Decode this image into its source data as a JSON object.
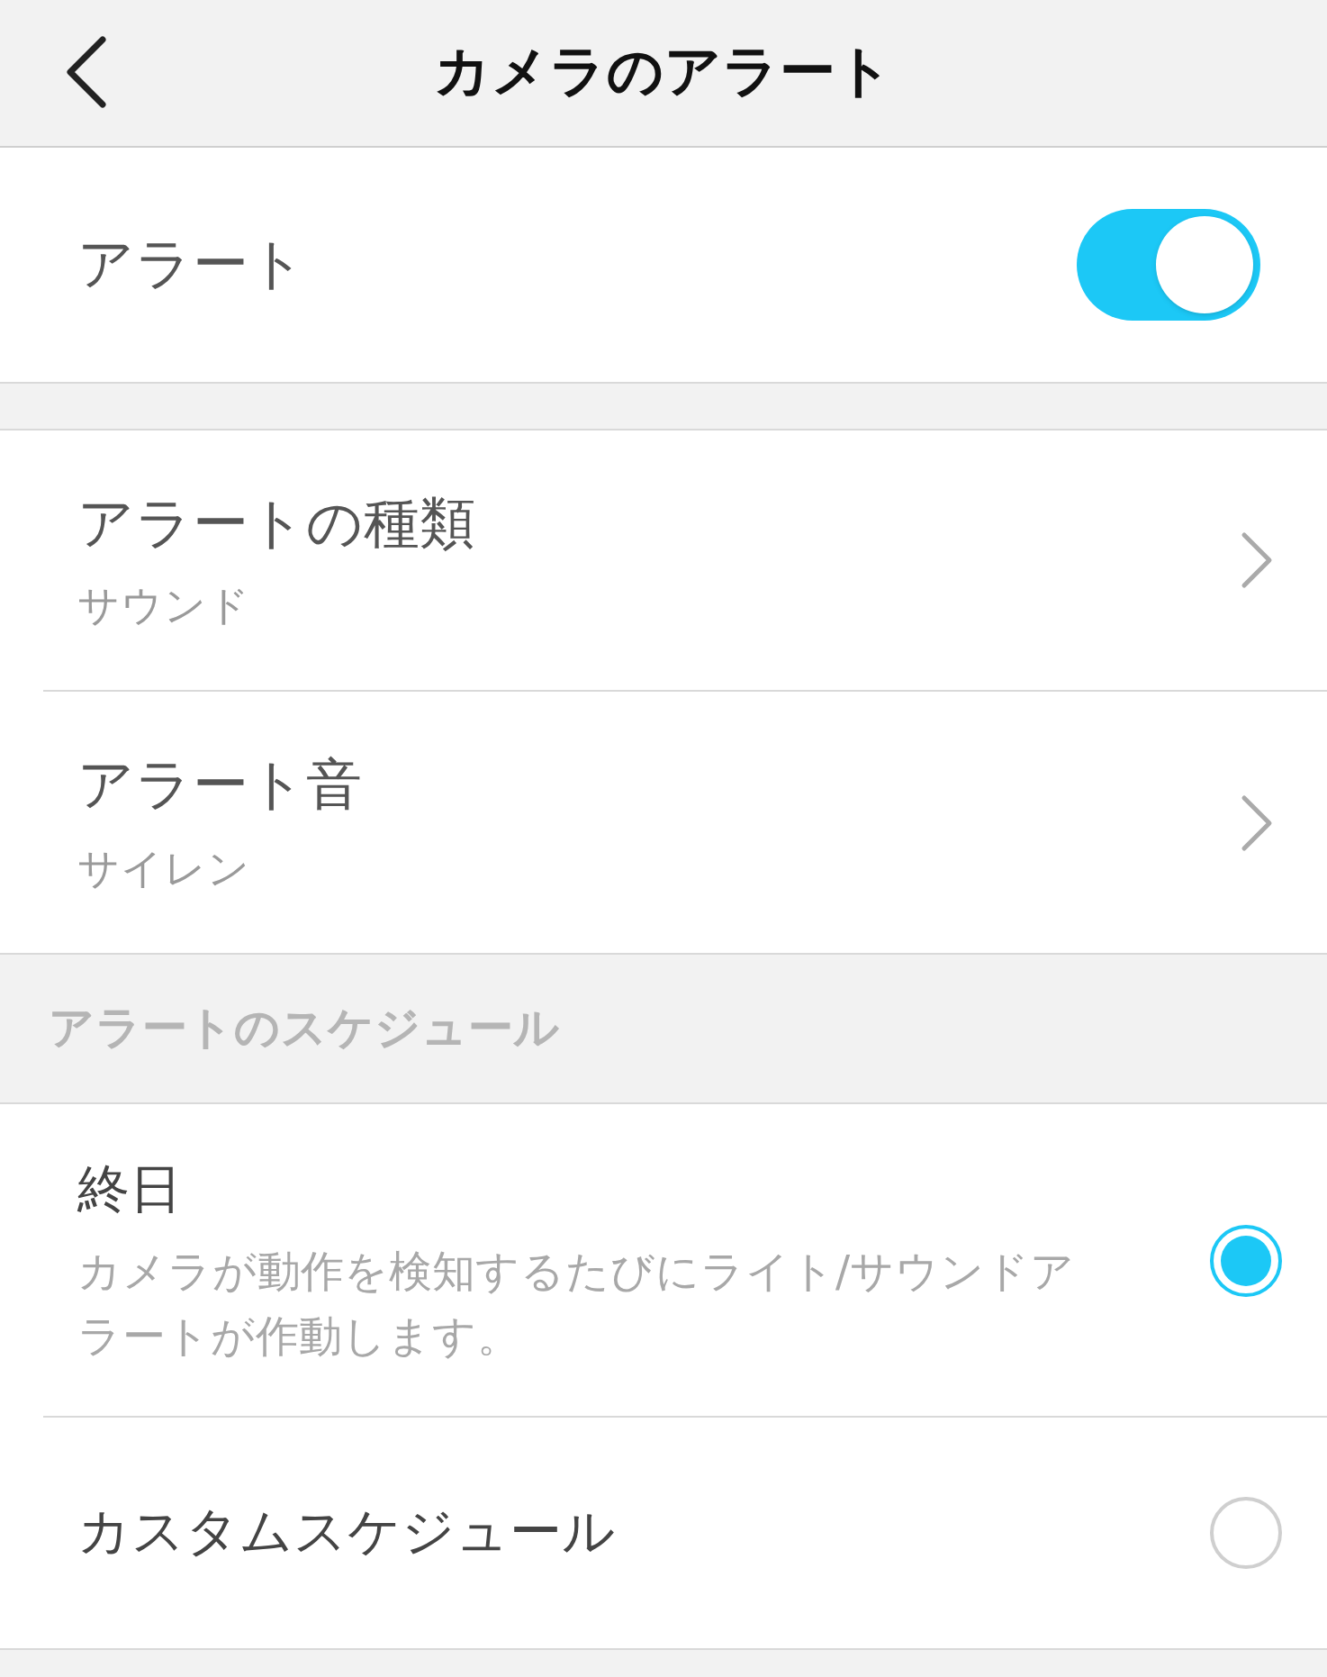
{
  "header": {
    "title": "カメラのアラート"
  },
  "alert": {
    "label": "アラート",
    "on": true
  },
  "settings": [
    {
      "label": "アラートの種類",
      "value": "サウンド"
    },
    {
      "label": "アラート音",
      "value": "サイレン"
    }
  ],
  "schedule": {
    "title": "アラートのスケジュール",
    "options": [
      {
        "label": "終日",
        "description": "カメラが動作を検知するたびにライト/サウンドアラートが作動します。",
        "selected": true
      },
      {
        "label": "カスタムスケジュール",
        "selected": false
      }
    ]
  }
}
